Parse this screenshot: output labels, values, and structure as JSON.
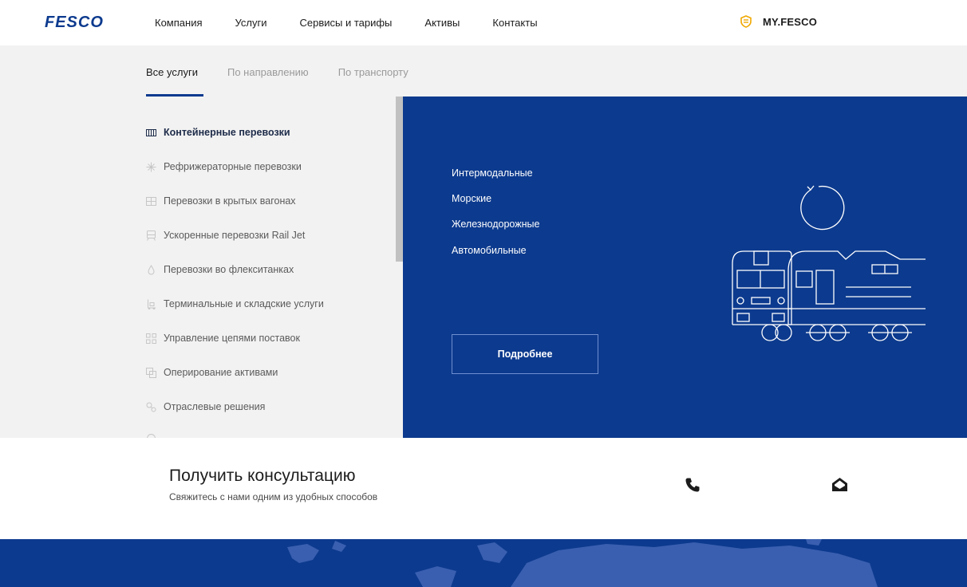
{
  "header": {
    "logo_text": "FESCO",
    "nav": [
      "Компания",
      "Услуги",
      "Сервисы и тарифы",
      "Активы",
      "Контакты"
    ],
    "account_label": "MY.FESCO"
  },
  "tabs": [
    {
      "label": "Все услуги",
      "active": true
    },
    {
      "label": "По направлению",
      "active": false
    },
    {
      "label": "По транспорту",
      "active": false
    }
  ],
  "services": [
    {
      "label": "Контейнерные перевозки",
      "icon": "container-icon",
      "active": true
    },
    {
      "label": "Рефрижераторные перевозки",
      "icon": "snowflake-icon",
      "active": false
    },
    {
      "label": "Перевозки в крытых вагонах",
      "icon": "wagon-icon",
      "active": false
    },
    {
      "label": "Ускоренные перевозки Rail Jet",
      "icon": "train-icon",
      "active": false
    },
    {
      "label": "Перевозки во флекситанках",
      "icon": "drop-icon",
      "active": false
    },
    {
      "label": "Терминальные и складские услуги",
      "icon": "forklift-icon",
      "active": false
    },
    {
      "label": "Управление цепями поставок",
      "icon": "supply-chain-icon",
      "active": false
    },
    {
      "label": "Оперирование активами",
      "icon": "assets-icon",
      "active": false
    },
    {
      "label": "Отраслевые решения",
      "icon": "industry-icon",
      "active": false
    }
  ],
  "panel": {
    "subservices": [
      "Интермодальные",
      "Морские",
      "Железнодорожные",
      "Автомобильные"
    ],
    "button_label": "Подробнее"
  },
  "consultation": {
    "title": "Получить консультацию",
    "subtitle": "Свяжитесь с нами одним из удобных способов"
  },
  "colors": {
    "brand_blue": "#0c3a8e",
    "accent_gold": "#f0a800",
    "band_gray": "#f2f2f2"
  }
}
